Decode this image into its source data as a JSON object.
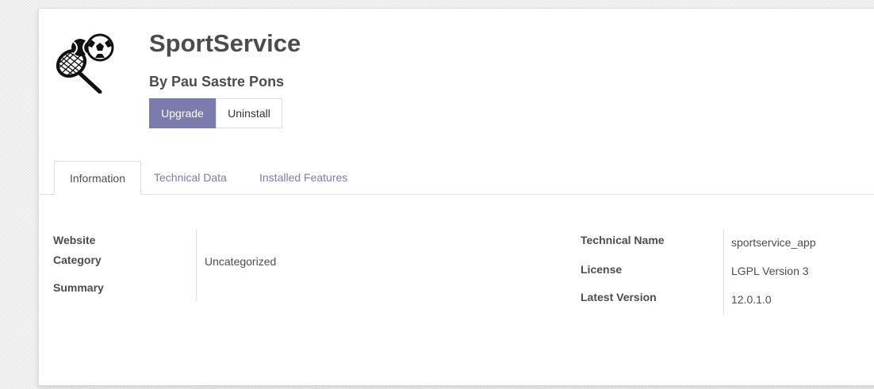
{
  "module": {
    "name": "SportService",
    "author": "By Pau Sastre Pons",
    "icon": "sport-balls-racket-icon"
  },
  "actions": {
    "upgrade_label": "Upgrade",
    "uninstall_label": "Uninstall"
  },
  "tabs": [
    {
      "label": "Information",
      "active": true
    },
    {
      "label": "Technical Data",
      "active": false
    },
    {
      "label": "Installed Features",
      "active": false
    }
  ],
  "info": {
    "website_label": "Website",
    "website_value": "",
    "category_label": "Category",
    "category_value": "Uncategorized",
    "summary_label": "Summary",
    "summary_value": "",
    "technical_name_label": "Technical Name",
    "technical_name_value": "sportservice_app",
    "license_label": "License",
    "license_value": "LGPL Version 3",
    "latest_version_label": "Latest Version",
    "latest_version_value": "12.0.1.0"
  },
  "colors": {
    "primary": "#7c7bad",
    "text": "#4c4c4c",
    "border": "#dddddd"
  }
}
